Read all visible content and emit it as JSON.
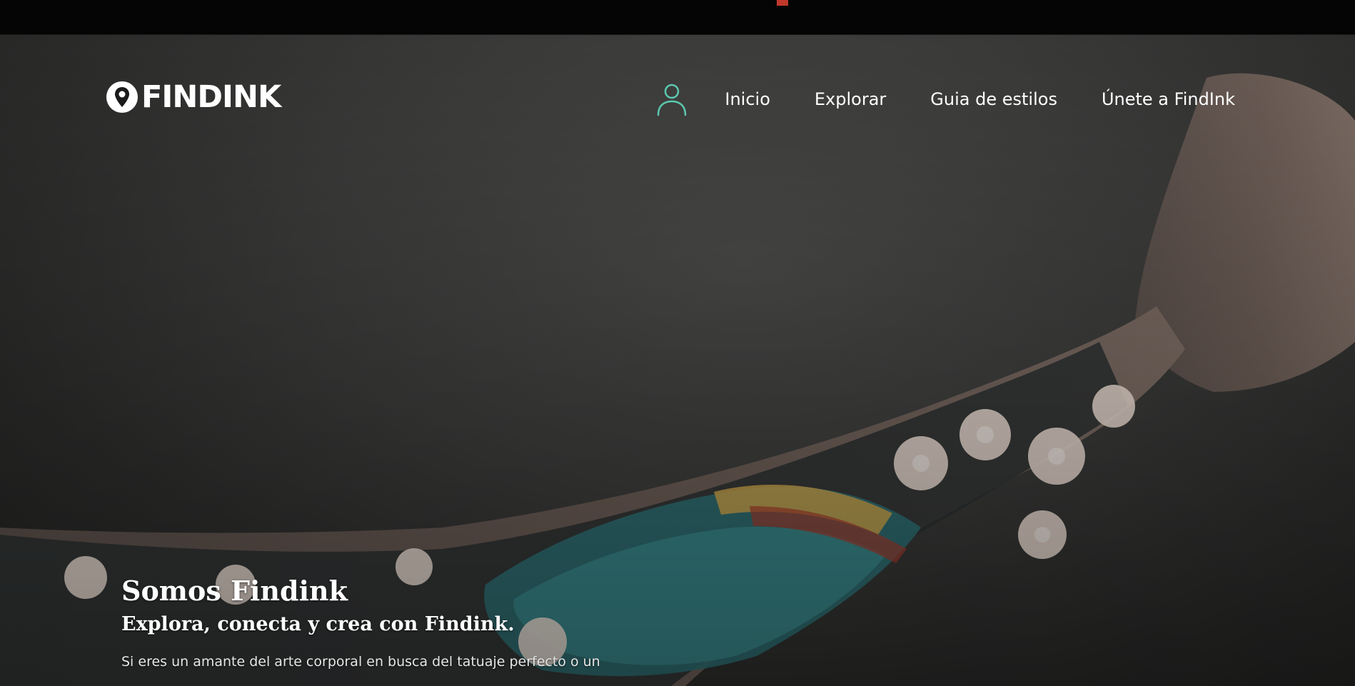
{
  "brand": {
    "logo_text": "FINDINK",
    "logo_icon": "location-pin-icon"
  },
  "nav": {
    "account_icon": "user-icon",
    "items": [
      {
        "label": "Inicio"
      },
      {
        "label": "Explorar"
      },
      {
        "label": "Guia de estilos"
      },
      {
        "label": "Únete a FindInk"
      }
    ]
  },
  "hero": {
    "title": "Somos Findink",
    "subtitle": "Explora, conecta y crea con Findink.",
    "body": "Si eres un amante del arte corporal en busca del tatuaje perfecto o un",
    "background_image": "tattooed-forearm-photo"
  },
  "colors": {
    "accent": "#5cc8b0",
    "top_marker": "#c0392b",
    "text": "#ffffff"
  }
}
